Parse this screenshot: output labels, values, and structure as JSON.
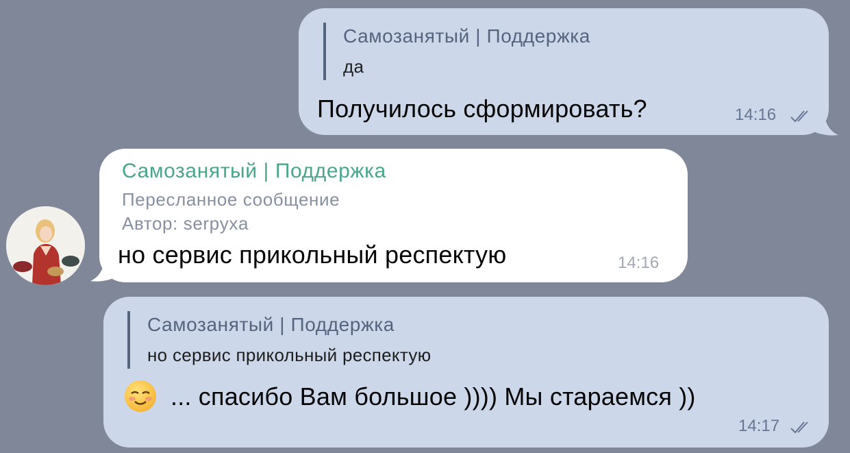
{
  "messages": [
    {
      "id": "msg1",
      "direction": "outgoing",
      "reply": {
        "sender": "Самозанятый | Поддержка",
        "text": "да"
      },
      "text": "Получилось сформировать?",
      "time": "14:16",
      "status": "read"
    },
    {
      "id": "msg2",
      "direction": "incoming",
      "sender": "Самозанятый | Поддержка",
      "forwarded_label": "Пересланное сообщение",
      "author": "Автор: serpyxa",
      "text": "но сервис прикольный респектую",
      "time": "14:16"
    },
    {
      "id": "msg3",
      "direction": "outgoing",
      "reply": {
        "sender": "Самозанятый | Поддержка",
        "text": "но сервис прикольный респектую"
      },
      "emoji": "☺️",
      "text": "... спасибо Вам большое )))) Мы стараемся ))",
      "time": "14:17",
      "status": "read"
    }
  ],
  "colors": {
    "background": "#7f8799",
    "outgoing_bubble": "#ccd7e9",
    "incoming_bubble": "#ffffff",
    "forward_sender": "#4aa58c",
    "reply_accent": "#55647e"
  },
  "icons": {
    "read_status": "double-check-icon",
    "avatar": "woman-on-phone-avatar"
  }
}
